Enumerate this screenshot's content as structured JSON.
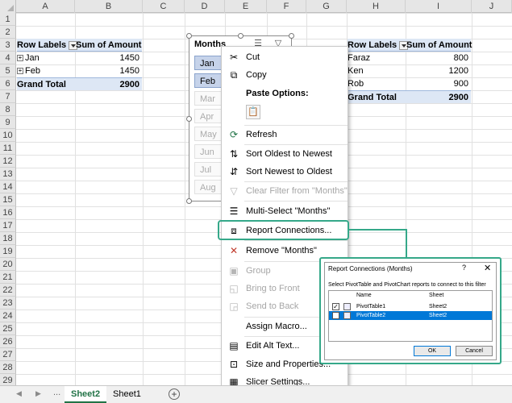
{
  "columns": [
    "A",
    "B",
    "C",
    "D",
    "E",
    "F",
    "G",
    "H",
    "I",
    "J"
  ],
  "rows": [
    "1",
    "2",
    "3",
    "4",
    "5",
    "6",
    "7",
    "8",
    "9",
    "10",
    "11",
    "12",
    "13",
    "14",
    "15",
    "16",
    "17",
    "18",
    "19",
    "20",
    "21",
    "22",
    "23",
    "24",
    "25",
    "26",
    "27",
    "28",
    "29"
  ],
  "pivot_left": {
    "header_label": "Row Labels",
    "header_value": "Sum of Amount",
    "rows": [
      {
        "label": "Jan",
        "value": "1450"
      },
      {
        "label": "Feb",
        "value": "1450"
      }
    ],
    "total_label": "Grand Total",
    "total_value": "2900"
  },
  "pivot_right": {
    "header_label": "Row Labels",
    "header_value": "Sum of Amount",
    "rows": [
      {
        "label": "Faraz",
        "value": "800"
      },
      {
        "label": "Ken",
        "value": "1200"
      },
      {
        "label": "Rob",
        "value": "900"
      }
    ],
    "total_label": "Grand Total",
    "total_value": "2900"
  },
  "slicer": {
    "title": "Months",
    "items": [
      {
        "label": "Jan",
        "state": "selected"
      },
      {
        "label": "Feb",
        "state": "selected"
      },
      {
        "label": "Mar",
        "state": "disabled"
      },
      {
        "label": "Apr",
        "state": "disabled"
      },
      {
        "label": "May",
        "state": "disabled"
      },
      {
        "label": "Jun",
        "state": "disabled"
      },
      {
        "label": "Jul",
        "state": "disabled"
      },
      {
        "label": "Aug",
        "state": "disabled"
      }
    ]
  },
  "context_menu": {
    "cut": "Cut",
    "copy": "Copy",
    "paste_options": "Paste Options:",
    "refresh": "Refresh",
    "sort_oldest": "Sort Oldest to Newest",
    "sort_newest": "Sort Newest to Oldest",
    "clear_filter": "Clear Filter from \"Months\"",
    "multi_select": "Multi-Select \"Months\"",
    "report_connections": "Report Connections...",
    "remove": "Remove \"Months\"",
    "group": "Group",
    "bring_to_front": "Bring to Front",
    "send_to_back": "Send to Back",
    "assign_macro": "Assign Macro...",
    "edit_alt_text": "Edit Alt Text...",
    "size_properties": "Size and Properties...",
    "slicer_settings": "Slicer Settings..."
  },
  "dialog": {
    "title": "Report Connections (Months)",
    "help": "?",
    "close": "✕",
    "instructions": "Select PivotTable and PivotChart reports to connect to this filter",
    "col_name": "Name",
    "col_sheet": "Sheet",
    "items": [
      {
        "name": "PivotTable1",
        "sheet": "Sheet2",
        "checked": true
      },
      {
        "name": "PivotTable2",
        "sheet": "Sheet2",
        "checked": false
      }
    ],
    "ok": "OK",
    "cancel": "Cancel"
  },
  "tabs": {
    "ellipsis": "...",
    "sheets": [
      {
        "name": "Sheet2",
        "active": true
      },
      {
        "name": "Sheet1",
        "active": false
      }
    ],
    "add": "+"
  },
  "accent_color": "#35a889",
  "selection_color": "#0078d7"
}
